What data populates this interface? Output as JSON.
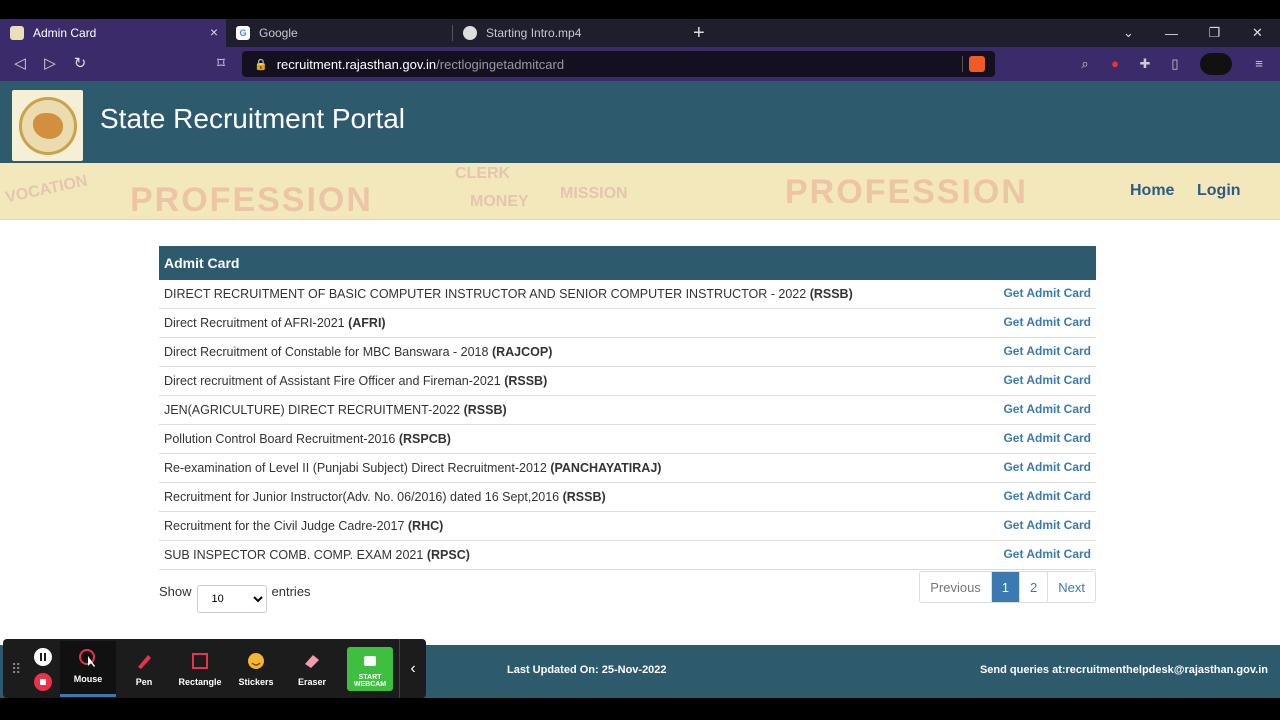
{
  "browser": {
    "tabs": [
      {
        "title": "Admin Card",
        "active": true
      },
      {
        "title": "Google",
        "active": false
      },
      {
        "title": "Starting Intro.mp4",
        "active": false
      }
    ],
    "url_host": "recruitment.rajasthan.gov.in",
    "url_path": "/rectlogingetadmitcard"
  },
  "site": {
    "title": "State Recruitment Portal",
    "nav": {
      "home": "Home",
      "login": "Login"
    },
    "banner_words": [
      "PROFESSION",
      "PROFESSION",
      "VOCATION",
      "MISSION",
      "CLERK",
      "MONEY"
    ]
  },
  "card": {
    "heading": "Admit Card",
    "action_label": "Get Admit Card",
    "rows": [
      {
        "name": "DIRECT RECRUITMENT OF BASIC COMPUTER INSTRUCTOR AND SENIOR COMPUTER INSTRUCTOR - 2022",
        "org": "(RSSB)"
      },
      {
        "name": "Direct Recruitment of AFRI-2021",
        "org": "(AFRI)"
      },
      {
        "name": "Direct Recruitment of Constable for MBC Banswara - 2018",
        "org": "(RAJCOP)"
      },
      {
        "name": "Direct recruitment of Assistant Fire Officer and Fireman-2021",
        "org": "(RSSB)"
      },
      {
        "name": "JEN(AGRICULTURE) DIRECT RECRUITMENT-2022",
        "org": "(RSSB)"
      },
      {
        "name": "Pollution Control Board Recruitment-2016",
        "org": "(RSPCB)"
      },
      {
        "name": "Re-examination of Level II (Punjabi Subject) Direct Recruitment-2012",
        "org": "(PANCHAYATIRAJ)"
      },
      {
        "name": "Recruitment for Junior Instructor(Adv. No. 06/2016) dated 16 Sept,2016",
        "org": "(RSSB)"
      },
      {
        "name": "Recruitment for the Civil Judge Cadre-2017",
        "org": "(RHC)"
      },
      {
        "name": "SUB INSPECTOR COMB. COMP. EXAM 2021",
        "org": "(RPSC)"
      }
    ],
    "show_label": "Show",
    "entries_value": "10",
    "entries_label": "entries",
    "pager": {
      "previous": "Previous",
      "pages": [
        "1",
        "2"
      ],
      "current": "1",
      "next": "Next"
    }
  },
  "footer": {
    "last_updated": "Last Updated On: 25-Nov-2022",
    "queries": "Send queries at:recruitmenthelpdesk@rajasthan.gov.in"
  },
  "recorder": {
    "tools": [
      "Mouse",
      "Pen",
      "Rectangle",
      "Stickers",
      "Eraser"
    ],
    "selected": "Mouse",
    "webcam_label": "START WEBCAM"
  },
  "colors": {
    "header": "#2e5a6d",
    "link": "#3a7ab0",
    "browser_accent": "#3b2b6a"
  }
}
